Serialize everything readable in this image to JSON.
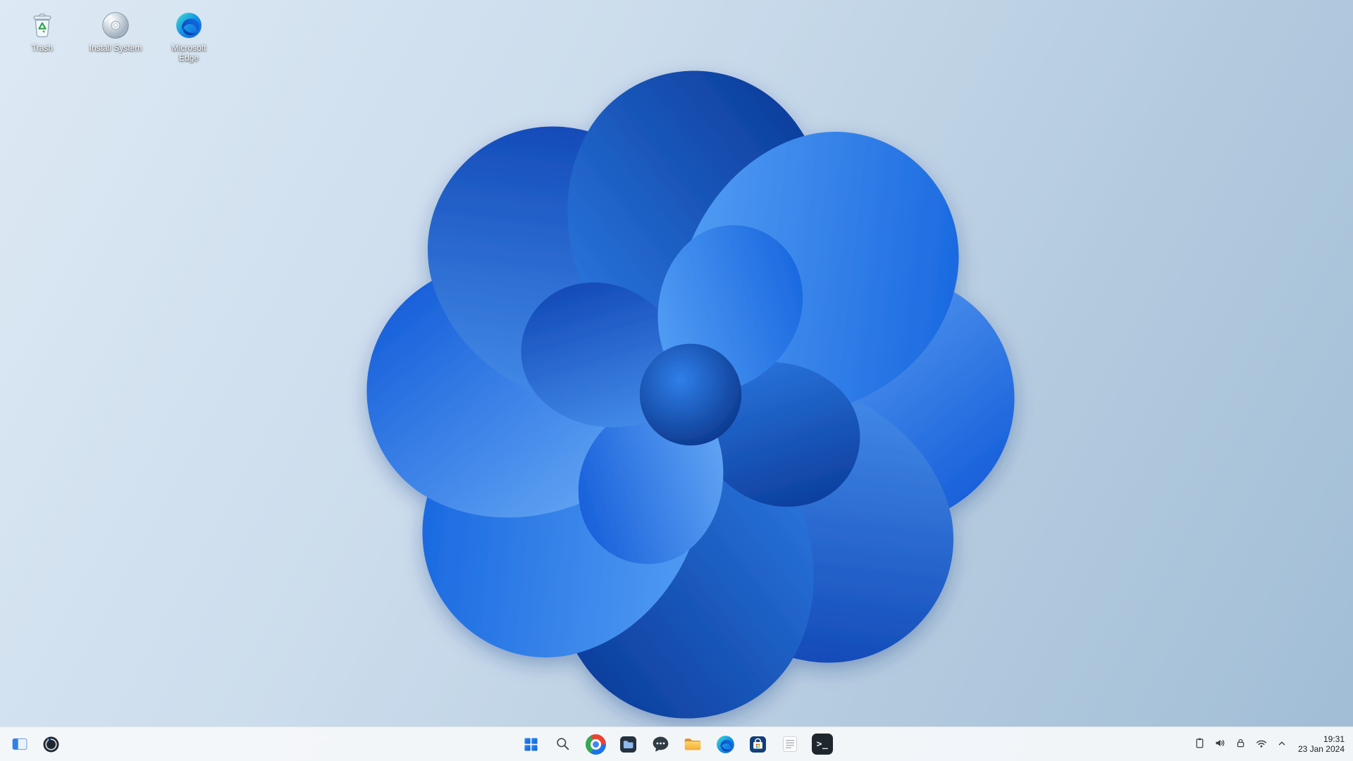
{
  "desktop": {
    "icons": [
      {
        "name": "trash",
        "label": "Trash"
      },
      {
        "name": "install-system",
        "label": "Install System"
      },
      {
        "name": "microsoft-edge",
        "label": "Microsoft Edge"
      }
    ]
  },
  "taskbar": {
    "left_items": [
      "sidebar-window",
      "swirl-logo"
    ],
    "center_items": [
      "start",
      "search",
      "color-wheel-browser",
      "dark-files",
      "chat",
      "file-explorer",
      "edge",
      "store",
      "notepad",
      "terminal"
    ],
    "tray_items": [
      "clipboard",
      "volume",
      "lock",
      "wifi",
      "chevron-up"
    ],
    "terminal_glyph": ">_",
    "clock": {
      "time": "19:31",
      "date": "23 Jan 2024"
    }
  },
  "colors": {
    "accent": "#0f6cef",
    "taskbar_background": "#f6f8fa",
    "wallpaper_light": "#dde9f4",
    "wallpaper_dark": "#a0bdd6",
    "bloom_light": "#71b3f9",
    "bloom_dark": "#083693"
  }
}
